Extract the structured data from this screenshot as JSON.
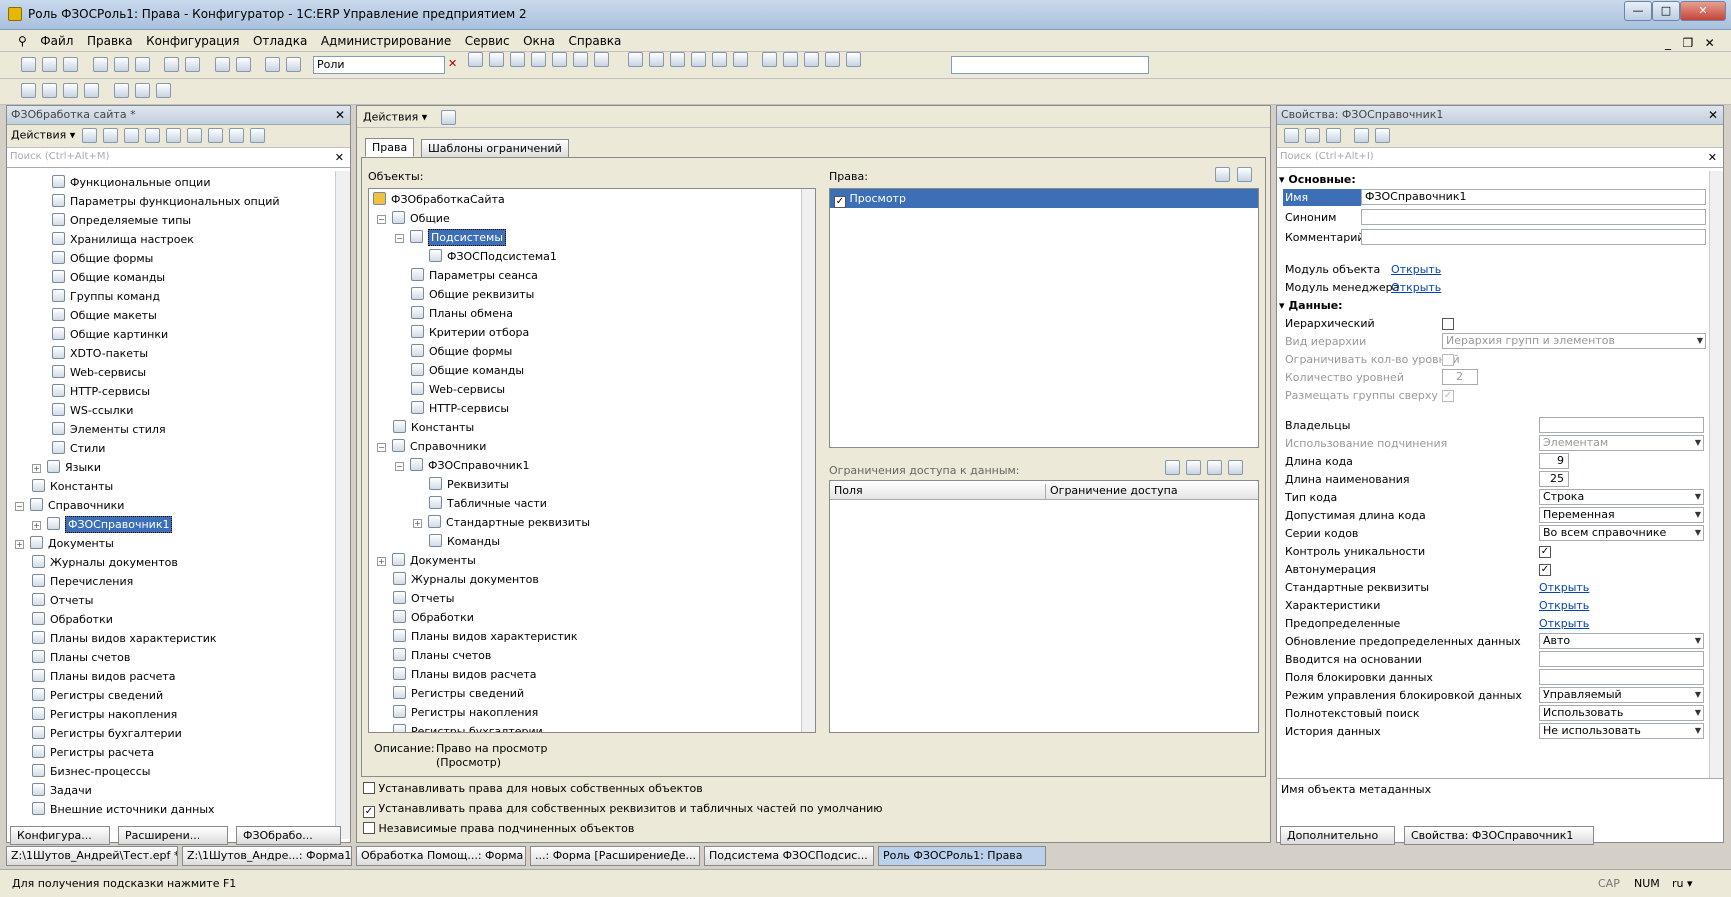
{
  "window": {
    "title": "Роль ФЗОСРоль1: Права - Конфигуратор - 1С:ERP Управление предприятием 2",
    "min": "—",
    "max": "□",
    "close": "✕"
  },
  "menu": [
    "Файл",
    "Правка",
    "Конфигурация",
    "Отладка",
    "Администрирование",
    "Сервис",
    "Окна",
    "Справка"
  ],
  "toolbar": {
    "search_value": "Роли"
  },
  "left": {
    "title": "ФЗОбработка сайта *",
    "actions": "Действия",
    "search_placeholder": "Поиск (Ctrl+Alt+M)",
    "items": [
      "Функциональные опции",
      "Параметры функциональных опций",
      "Определяемые типы",
      "Хранилища настроек",
      "Общие формы",
      "Общие команды",
      "Группы команд",
      "Общие макеты",
      "Общие картинки",
      "XDTO-пакеты",
      "Web-сервисы",
      "HTTP-сервисы",
      "WS-ссылки",
      "Элементы стиля",
      "Стили",
      "Языки",
      "Константы",
      "Справочники",
      "ФЗОСправочник1",
      "Документы",
      "Журналы документов",
      "Перечисления",
      "Отчеты",
      "Обработки",
      "Планы видов характеристик",
      "Планы счетов",
      "Планы видов расчета",
      "Регистры сведений",
      "Регистры накопления",
      "Регистры бухгалтерии",
      "Регистры расчета",
      "Бизнес-процессы",
      "Задачи",
      "Внешние источники данных"
    ],
    "tabs": [
      "Конфигура...",
      "Расширени...",
      "ФЗОбрабо..."
    ]
  },
  "center": {
    "actions": "Действия",
    "tabs": [
      "Права",
      "Шаблоны ограничений"
    ],
    "objects_label": "Объекты:",
    "rights_label": "Права:",
    "tree": [
      "ФЗОбработкаСайта",
      "Общие",
      "Подсистемы",
      "ФЗОСПодсистема1",
      "Параметры сеанса",
      "Общие реквизиты",
      "Планы обмена",
      "Критерии отбора",
      "Общие формы",
      "Общие команды",
      "Web-сервисы",
      "HTTP-сервисы",
      "Константы",
      "Справочники",
      "ФЗОСправочник1",
      "Реквизиты",
      "Табличные части",
      "Стандартные реквизиты",
      "Команды",
      "Документы",
      "Журналы документов",
      "Отчеты",
      "Обработки",
      "Планы видов характеристик",
      "Планы счетов",
      "Планы видов расчета",
      "Регистры сведений",
      "Регистры накопления",
      "Регистры бухгалтерии"
    ],
    "right_item": "Просмотр",
    "restrictions_label": "Ограничения доступа к данным:",
    "col_fields": "Поля",
    "col_restriction": "Ограничение доступа",
    "desc_label": "Описание:",
    "desc_value": "Право на просмотр",
    "desc_value2": "(Просмотр)",
    "chk1": "Устанавливать права для новых собственных объектов",
    "chk2": "Устанавливать права для собственных реквизитов и табличных частей по умолчанию",
    "chk3": "Независимые права подчиненных объектов"
  },
  "props": {
    "title": "Свойства: ФЗОСправочник1",
    "search_placeholder": "Поиск (Ctrl+Alt+I)",
    "sec_main": "Основные:",
    "name_lbl": "Имя",
    "name_val": "ФЗОСправочник1",
    "syn_lbl": "Синоним",
    "comment_lbl": "Комментарий",
    "obj_module": "Модуль объекта",
    "mgr_module": "Модуль менеджера",
    "open": "Открыть",
    "sec_data": "Данные:",
    "hier": "Иерархический",
    "hier_kind": "Вид иерархии",
    "hier_kind_val": "Иерархия групп и элементов",
    "limit_levels": "Ограничивать кол-во уровней",
    "levels": "Количество уровней",
    "levels_val": "2",
    "groups_top": "Размещать группы сверху",
    "owners": "Владельцы",
    "subord": "Использование подчинения",
    "subord_val": "Элементам",
    "code_len": "Длина кода",
    "code_len_val": "9",
    "name_len": "Длина наименования",
    "name_len_val": "25",
    "code_type": "Тип кода",
    "code_type_val": "Строка",
    "allowed_len": "Допустимая длина кода",
    "allowed_len_val": "Переменная",
    "code_series": "Серии кодов",
    "code_series_val": "Во всем справочнике",
    "uniq": "Контроль уникальности",
    "autonum": "Автонумерация",
    "std_req": "Стандартные реквизиты",
    "chars": "Характеристики",
    "predef": "Предопределенные",
    "upd_predef": "Обновление предопределенных данных",
    "upd_predef_val": "Авто",
    "based_on": "Вводится на основании",
    "lock_fields": "Поля блокировки данных",
    "lock_mode": "Режим управления блокировкой данных",
    "lock_mode_val": "Управляемый",
    "fulltext": "Полнотекстовый поиск",
    "fulltext_val": "Использовать",
    "history": "История данных",
    "history_val": "Не использовать",
    "hint": "Имя объекта метаданных",
    "tab_more": "Дополнительно",
    "tab_props": "Свойства: ФЗОСправочник1"
  },
  "wintabs": [
    "Z:\\1Шутов_Андрей\\Тест.epf *",
    "Z:\\1Шутов_Андре...: Форма1",
    "Обработка Помощ...: Форма",
    "...: Форма [РасширениеДе...",
    "Подсистема ФЗОСПодсис...",
    "Роль ФЗОСРоль1: Права"
  ],
  "status": {
    "hint": "Для получения подсказки нажмите F1",
    "cap": "CAP",
    "num": "NUM",
    "lang": "ru ▾"
  }
}
